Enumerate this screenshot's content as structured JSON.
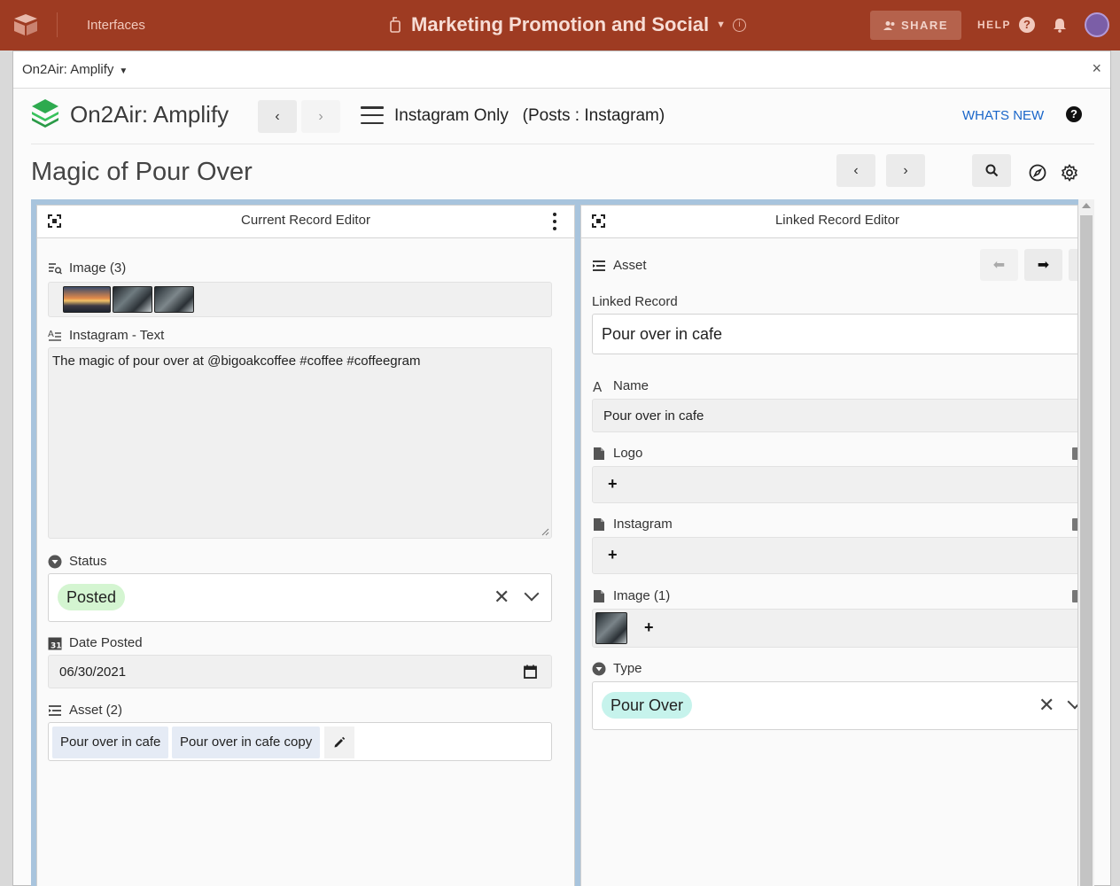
{
  "topbar": {
    "section": "Interfaces",
    "base_title": "Marketing Promotion and Social",
    "share_label": "SHARE",
    "help_label": "HELP"
  },
  "panel": {
    "extension_name": "On2Air: Amplify",
    "close_label": "×"
  },
  "app": {
    "title": "On2Air: Amplify",
    "view_name": "Instagram Only",
    "view_table": "(Posts : Instagram)",
    "whats_new_label": "WHATS NEW",
    "help_label": "?"
  },
  "record": {
    "title": "Magic of Pour Over"
  },
  "current_editor": {
    "title": "Current Record Editor",
    "image_label": "Image (3)",
    "text_label": "Instagram - Text",
    "text_value": "The magic of pour over at @bigoakcoffee #coffee #coffeegram",
    "status_label": "Status",
    "status_value": "Posted",
    "status_color": "#d4f5d1",
    "date_label": "Date Posted",
    "date_value": "06/30/2021",
    "asset_label": "Asset (2)",
    "assets": [
      "Pour over in cafe",
      "Pour over in cafe copy"
    ]
  },
  "linked_editor": {
    "title": "Linked Record Editor",
    "asset_label": "Asset",
    "linked_record_label": "Linked Record",
    "linked_record_value": "Pour over in cafe",
    "name_label": "Name",
    "name_value": "Pour over in cafe",
    "logo_label": "Logo",
    "instagram_label": "Instagram",
    "image_label": "Image (1)",
    "type_label": "Type",
    "type_value": "Pour Over",
    "type_color": "#c6f3ec",
    "add_label": "+"
  },
  "icons": {
    "nav_prev": "chevron-left-icon",
    "nav_next": "chevron-right-icon",
    "search": "search-icon",
    "compass": "compass-icon",
    "settings": "gear-icon"
  }
}
